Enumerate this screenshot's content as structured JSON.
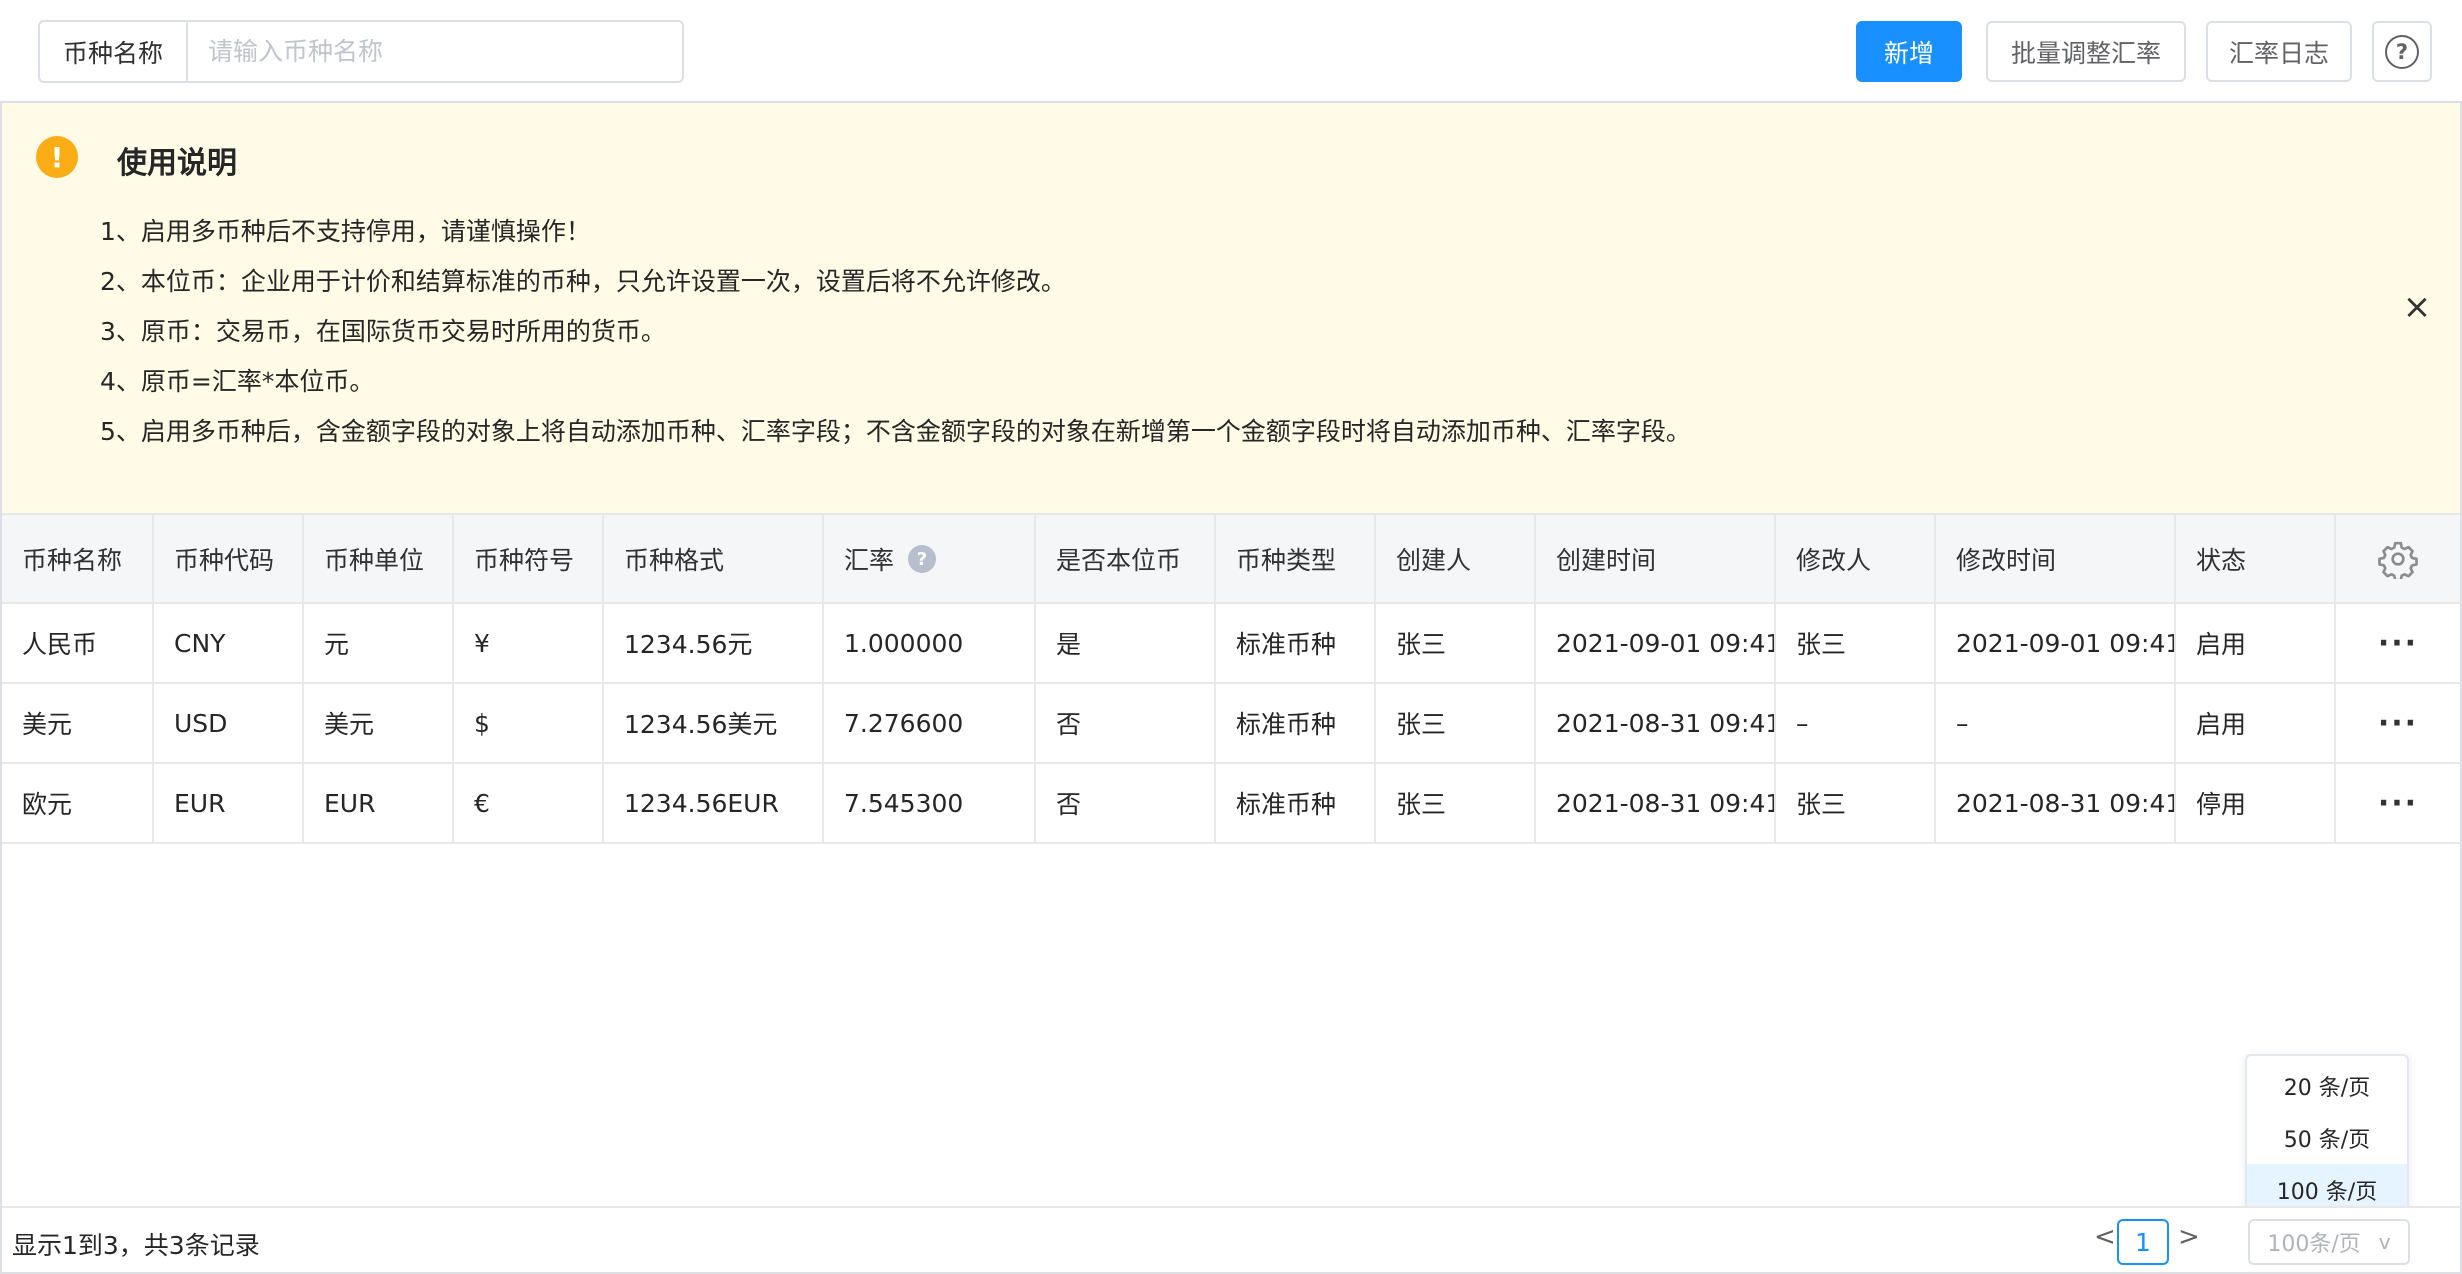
{
  "toolbar": {
    "search_label": "币种名称",
    "search_placeholder": "请输入币种名称",
    "add_label": "新增",
    "batch_label": "批量调整汇率",
    "log_label": "汇率日志",
    "help_glyph": "?"
  },
  "notice": {
    "icon_glyph": "!",
    "title": "使用说明",
    "lines": [
      "1、启用多币种后不支持停用，请谨慎操作！",
      "2、本位币：企业用于计价和结算标准的币种，只允许设置一次，设置后将不允许修改。",
      "3、原币：交易币，在国际货币交易时所用的货币。",
      "4、原币=汇率*本位币。",
      "5、启用多币种后，含金额字段的对象上将自动添加币种、汇率字段；不含金额字段的对象在新增第一个金额字段时将自动添加币种、汇率字段。"
    ],
    "close_glyph": "×"
  },
  "table": {
    "headers": [
      "币种名称",
      "币种代码",
      "币种单位",
      "币种符号",
      "币种格式",
      "汇率",
      "是否本位币",
      "币种类型",
      "创建人",
      "创建时间",
      "修改人",
      "修改时间",
      "状态"
    ],
    "rate_help_glyph": "?",
    "rows": [
      [
        "人民币",
        "CNY",
        "元",
        "¥",
        "1234.56元",
        "1.000000",
        "是",
        "标准币种",
        "张三",
        "2021-09-01 09:41",
        "张三",
        "2021-09-01 09:41",
        "启用"
      ],
      [
        "美元",
        "USD",
        "美元",
        "$",
        "1234.56美元",
        "7.276600",
        "否",
        "标准币种",
        "张三",
        "2021-08-31 09:41",
        "–",
        "–",
        "启用"
      ],
      [
        "欧元",
        "EUR",
        "EUR",
        "€",
        "1234.56EUR",
        "7.545300",
        "否",
        "标准币种",
        "张三",
        "2021-08-31 09:41",
        "张三",
        "2021-08-31 09:41",
        "停用"
      ]
    ],
    "row_action_glyph": "···",
    "settings_icon": "gear-icon"
  },
  "pagination": {
    "summary": "显示1到3，共3条记录",
    "prev_glyph": "<",
    "current_page": "1",
    "next_glyph": ">",
    "page_size_value": "100条/页",
    "page_size_chevron": "v",
    "page_size_options": [
      "20 条/页",
      "50 条/页",
      "100 条/页"
    ],
    "selected_option_index": 2
  },
  "colors": {
    "primary": "#1890ff",
    "notice_bg": "#fffbe6",
    "warning": "#faad14",
    "header_bg": "#f5f6f8",
    "selected_option_bg": "#e6f4ff"
  }
}
